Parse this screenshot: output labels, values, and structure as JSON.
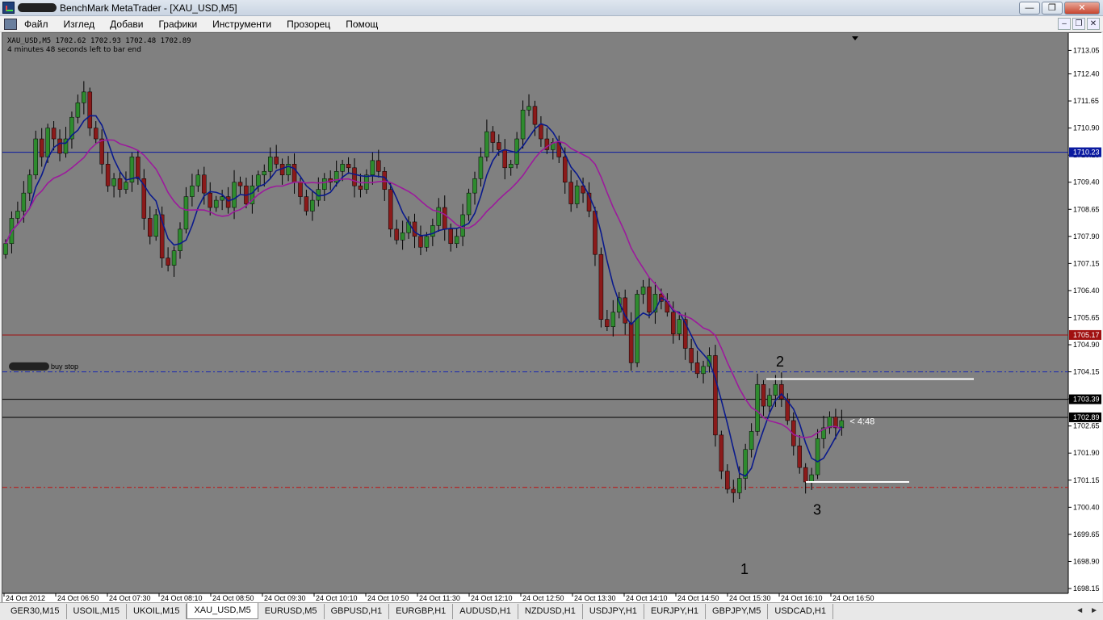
{
  "window": {
    "title": "BenchMark MetaTrader - [XAU_USD,M5]"
  },
  "window_buttons": {
    "minimize": "—",
    "maximize": "❐",
    "close": "✕"
  },
  "menu": [
    "Файл",
    "Изглед",
    "Добави",
    "Графики",
    "Инструменти",
    "Прозорец",
    "Помощ"
  ],
  "mdi_buttons": {
    "minimize": "–",
    "restore": "❐",
    "close": "✕"
  },
  "chart": {
    "ohlc_text": "XAU_USD,M5  1702.62 1702.93 1702.48 1702.89",
    "bar_timer_text": "4 minutes 48 seconds left to bar end",
    "order_label": "buy stop",
    "countdown": "< 4:48",
    "markers": [
      "1",
      "2",
      "3"
    ],
    "colors": {
      "background": "#808080",
      "bull": "#2e8b2e",
      "bear": "#8b1a1a",
      "ma_fast": "#0a1a8c",
      "ma_slow": "#9c1a9c"
    }
  },
  "chart_data": {
    "type": "candlestick",
    "title": "",
    "symbol": "XAU_USD",
    "timeframe": "M5",
    "ylim": [
      1698.15,
      1713.35
    ],
    "y_ticks": [
      "1713.05",
      "1712.40",
      "1711.65",
      "1710.90",
      "1710.15",
      "1709.40",
      "1708.65",
      "1707.90",
      "1707.15",
      "1706.40",
      "1705.65",
      "1704.90",
      "1704.15",
      "1703.40",
      "1702.65",
      "1701.90",
      "1701.15",
      "1700.40",
      "1699.65",
      "1698.90",
      "1698.15"
    ],
    "x_ticks": [
      "24 Oct 2012",
      "24 Oct 06:50",
      "24 Oct 07:30",
      "24 Oct 08:10",
      "24 Oct 08:50",
      "24 Oct 09:30",
      "24 Oct 10:10",
      "24 Oct 10:50",
      "24 Oct 11:30",
      "24 Oct 12:10",
      "24 Oct 12:50",
      "24 Oct 13:30",
      "24 Oct 14:10",
      "24 Oct 14:50",
      "24 Oct 15:30",
      "24 Oct 16:10",
      "24 Oct 16:50"
    ],
    "price_labels": [
      {
        "value": 1710.23,
        "text": "1710.23",
        "color": "#0a1aa0",
        "line": "solid"
      },
      {
        "value": 1705.17,
        "text": "1705.17",
        "color": "#a01010",
        "line": "solid"
      },
      {
        "value": 1703.39,
        "text": "1703.39",
        "color": "#000000",
        "line": "solid"
      },
      {
        "value": 1702.89,
        "text": "1702.89",
        "color": "#000000",
        "line": "solid"
      }
    ],
    "order_lines": [
      {
        "value": 1704.15,
        "color": "#1a2ab0",
        "style": "dash-dot"
      },
      {
        "value": 1700.95,
        "color": "#c01010",
        "style": "dash-dot"
      }
    ],
    "closes": [
      1707.7,
      1708.4,
      1708.6,
      1709.1,
      1709.6,
      1710.6,
      1710.1,
      1710.9,
      1710.6,
      1710.2,
      1710.6,
      1711.2,
      1711.6,
      1711.9,
      1710.9,
      1710.6,
      1709.9,
      1709.3,
      1709.5,
      1709.2,
      1709.4,
      1710.1,
      1709.5,
      1708.4,
      1707.9,
      1708.5,
      1707.3,
      1707.1,
      1707.5,
      1708.1,
      1709.0,
      1709.3,
      1709.6,
      1709.1,
      1708.7,
      1708.9,
      1709.0,
      1708.7,
      1709.4,
      1709.3,
      1708.8,
      1709.3,
      1709.6,
      1709.7,
      1710.1,
      1709.9,
      1709.6,
      1709.9,
      1709.4,
      1709.0,
      1708.6,
      1708.9,
      1709.2,
      1709.5,
      1709.4,
      1709.7,
      1709.9,
      1709.8,
      1709.3,
      1709.2,
      1709.6,
      1710.0,
      1709.7,
      1709.2,
      1708.1,
      1707.8,
      1708.0,
      1708.3,
      1707.9,
      1707.6,
      1707.9,
      1708.2,
      1708.7,
      1708.1,
      1707.7,
      1707.9,
      1708.5,
      1709.1,
      1709.5,
      1710.1,
      1710.8,
      1710.5,
      1710.3,
      1709.8,
      1709.9,
      1710.6,
      1711.4,
      1711.5,
      1711.0,
      1710.6,
      1710.3,
      1710.5,
      1710.1,
      1709.4,
      1708.8,
      1709.3,
      1709.1,
      1708.6,
      1707.4,
      1705.6,
      1705.4,
      1705.8,
      1706.2,
      1705.5,
      1704.4,
      1706.3,
      1706.5,
      1705.8,
      1706.3,
      1706.1,
      1705.8,
      1705.2,
      1705.6,
      1704.8,
      1704.4,
      1704.1,
      1704.3,
      1704.6,
      1702.4,
      1701.4,
      1700.9,
      1700.8,
      1701.2,
      1702.0,
      1702.5,
      1703.8,
      1703.2,
      1703.5,
      1703.8,
      1703.4,
      1702.8,
      1702.1,
      1701.5,
      1701.1,
      1701.3,
      1702.3,
      1702.6,
      1702.9,
      1702.6,
      1702.8
    ]
  },
  "symbol_tabs": [
    "GER30,M15",
    "USOIL,M15",
    "UKOIL,M15",
    "XAU_USD,M5",
    "EURUSD,M5",
    "GBPUSD,H1",
    "EURGBP,H1",
    "AUDUSD,H1",
    "NZDUSD,H1",
    "USDJPY,H1",
    "EURJPY,H1",
    "GBPJPY,M5",
    "USDCAD,H1"
  ],
  "active_tab": "XAU_USD,M5",
  "tab_arrows": {
    "left": "◄",
    "right": "►"
  }
}
